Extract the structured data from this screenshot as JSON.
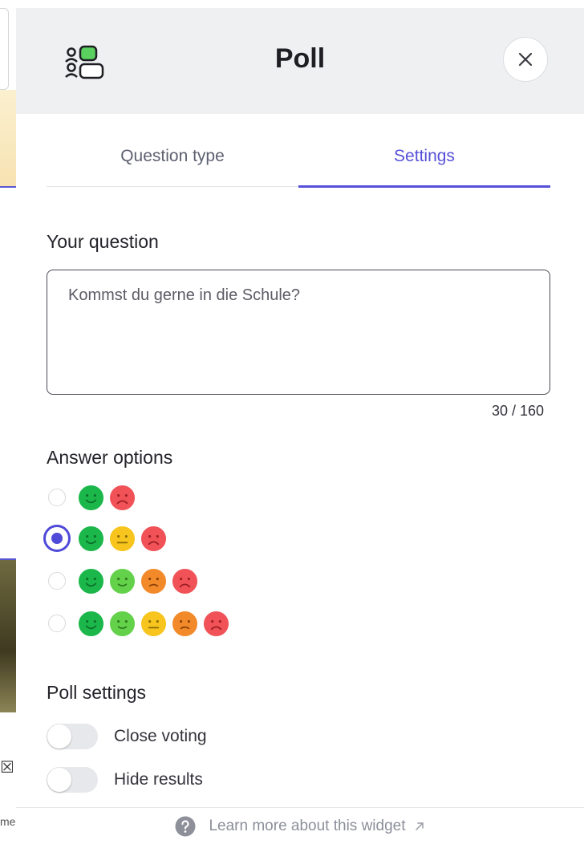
{
  "background": {
    "fragment_text": "me"
  },
  "header": {
    "title": "Poll",
    "icon": "poll-icon",
    "close_icon": "close-icon"
  },
  "tabs": [
    {
      "label": "Question type",
      "active": false
    },
    {
      "label": "Settings",
      "active": true
    }
  ],
  "question": {
    "label": "Your question",
    "value": "",
    "placeholder": "Kommst du gerne in die Schule?",
    "counter": "30 / 160"
  },
  "answer_options": {
    "label": "Answer options",
    "options": [
      {
        "selected": false,
        "faces": [
          "happy-green",
          "sad-red"
        ]
      },
      {
        "selected": true,
        "faces": [
          "happy-green",
          "neutral-yellow",
          "sad-red"
        ]
      },
      {
        "selected": false,
        "faces": [
          "happy-green",
          "smile-lightgreen",
          "frown-orange",
          "sad-red"
        ]
      },
      {
        "selected": false,
        "faces": [
          "happy-green",
          "smile-lightgreen",
          "neutral-yellow",
          "frown-orange",
          "sad-red"
        ]
      }
    ]
  },
  "poll_settings": {
    "label": "Poll settings",
    "toggles": [
      {
        "label": "Close voting",
        "on": false
      },
      {
        "label": "Hide results",
        "on": false
      }
    ]
  },
  "footer": {
    "link_text": "Learn more about this widget",
    "help_icon": "help-icon",
    "arrow_icon": "external-link-icon"
  },
  "colors": {
    "accent": "#5650d8",
    "green": "#1bb74a",
    "light_green": "#63d14a",
    "yellow": "#f7c51e",
    "orange": "#f28a2a",
    "red": "#f05257"
  }
}
